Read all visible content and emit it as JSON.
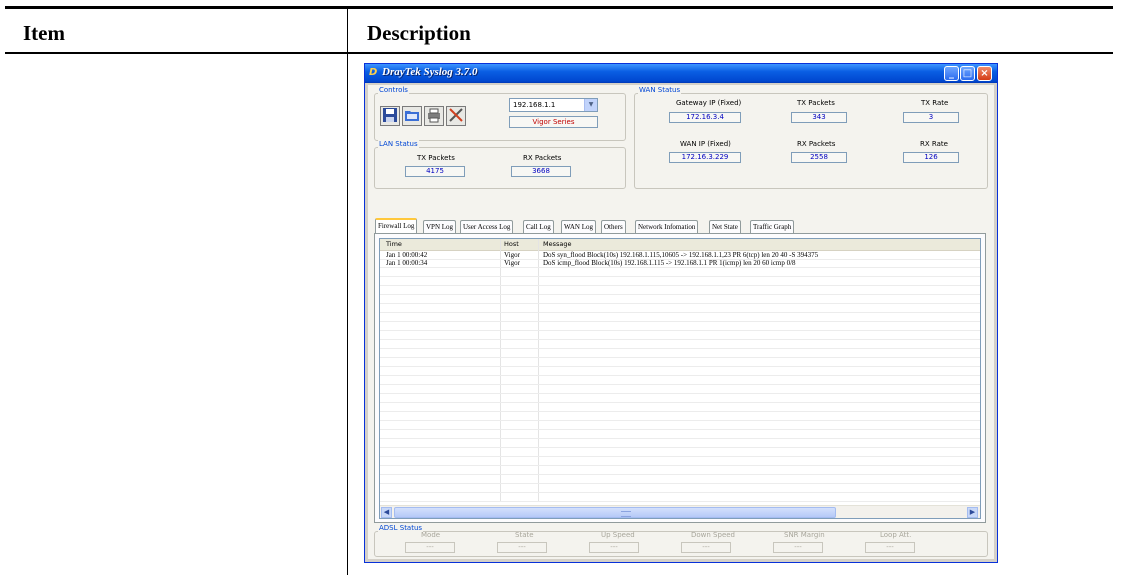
{
  "document": {
    "col_item": "Item",
    "col_description": "Description"
  },
  "window": {
    "title": "DrayTek Syslog 3.7.0",
    "controls_buttons": {
      "minimize": "_",
      "maximize": "□",
      "close": "×"
    }
  },
  "controls": {
    "group_label": "Controls",
    "ip_value": "192.168.1.1",
    "series_label": "Vigor Series",
    "tool_icons": [
      "save-icon",
      "open-folder-icon",
      "printer-icon",
      "tools-icon"
    ]
  },
  "lan_status": {
    "group_label": "LAN Status",
    "tx_label": "TX Packets",
    "tx_value": "4175",
    "rx_label": "RX Packets",
    "rx_value": "3668"
  },
  "wan_status": {
    "group_label": "WAN Status",
    "gateway_label": "Gateway IP (Fixed)",
    "gateway_value": "172.16.3.4",
    "tx_packets_label": "TX Packets",
    "tx_packets_value": "343",
    "tx_rate_label": "TX Rate",
    "tx_rate_value": "3",
    "wan_ip_label": "WAN IP (Fixed)",
    "wan_ip_value": "172.16.3.229",
    "rx_packets_label": "RX Packets",
    "rx_packets_value": "2558",
    "rx_rate_label": "RX Rate",
    "rx_rate_value": "126"
  },
  "tabs": [
    {
      "label": "Firewall Log",
      "active": true
    },
    {
      "label": "VPN Log"
    },
    {
      "label": "User Access Log"
    },
    {
      "label": "Call Log"
    },
    {
      "label": "WAN Log"
    },
    {
      "label": "Others"
    },
    {
      "label": "Network Infomation"
    },
    {
      "label": "Net State"
    },
    {
      "label": "Traffic Graph"
    }
  ],
  "log_table": {
    "columns": [
      "Time",
      "Host",
      "Message"
    ],
    "rows": [
      {
        "time": "Jan 1 00:00:42",
        "host": "Vigor",
        "message": "DoS syn_flood Block(10s) 192.168.1.115,10605 -> 192.168.1.1,23 PR 6(tcp) len 20 40 -S 394375"
      },
      {
        "time": "Jan 1 00:00:34",
        "host": "Vigor",
        "message": "DoS icmp_flood Block(10s) 192.168.1.115 -> 192.168.1.1 PR 1(icmp) len 20 60 icmp 0/8"
      }
    ]
  },
  "adsl_status": {
    "group_label": "ADSL Status",
    "fields": [
      {
        "label": "Mode",
        "value": "---"
      },
      {
        "label": "State",
        "value": "---"
      },
      {
        "label": "Up Speed",
        "value": "---"
      },
      {
        "label": "Down Speed",
        "value": "---"
      },
      {
        "label": "SNR Margin",
        "value": "---"
      },
      {
        "label": "Loop Att.",
        "value": "---"
      }
    ]
  }
}
